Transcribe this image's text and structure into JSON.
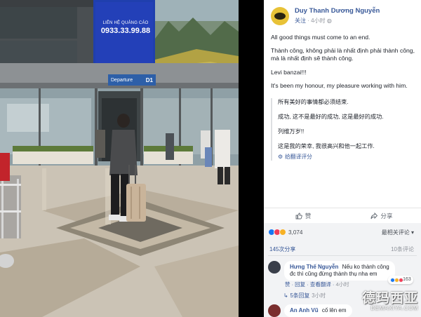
{
  "photo": {
    "billboard_label": "LIÊN HỆ QUẢNG CÁO",
    "billboard_phone": "0933.33.99.88",
    "sign_label": "Departure",
    "sign_gate": "D1"
  },
  "post": {
    "author": "Duy Thanh Dương Nguyễn",
    "follow_label": "关注",
    "timestamp": "4小时",
    "paragraphs": [
      "All good things must come to an end.",
      "Thành công, không phải là nhất định phải thành công, mà là nhất định sẽ thành công.",
      "Levi banzai!!!",
      "It's been my honour, my pleasure working with him."
    ],
    "translation": [
      "所有美好的事情都必须结束.",
      "成功, 这不是最好的成功, 这是最好的成功.",
      "列维万岁!!",
      "这是我的荣幸, 我很高兴和他一起工作."
    ],
    "rate_translation": "给翻译评分"
  },
  "actions": {
    "like": "赞",
    "share": "分享"
  },
  "engagement": {
    "reaction_count": "3,074",
    "sort_label": "最相关评论",
    "shares": "145次分享",
    "comments": "10条评论"
  },
  "comments": [
    {
      "name": "Hưng Thế Nguyễn",
      "text_line1": "Nếu ko thành công",
      "text_line2": "đc thì cũng đừng thành thụ nha em",
      "reaction_count": "163",
      "like_label": "赞",
      "reply_label": "回复",
      "translate_label": "查看翻译",
      "time": "4小时"
    },
    {
      "name": "An Anh Vũ",
      "text_line1": "cố lên em",
      "text_line2": "",
      "reaction_count": "",
      "like_label": "",
      "reply_label": "",
      "translate_label": "",
      "time": ""
    }
  ],
  "replies": {
    "label": "5条回复",
    "time": "3小时"
  },
  "watermark": {
    "main": "德玛西亚",
    "sub": "DEMAXIYA.COM"
  },
  "colors": {
    "fb_link": "#385898",
    "like_blue": "#1877f2",
    "love_red": "#f33e58",
    "haha_yellow": "#f7b125"
  }
}
